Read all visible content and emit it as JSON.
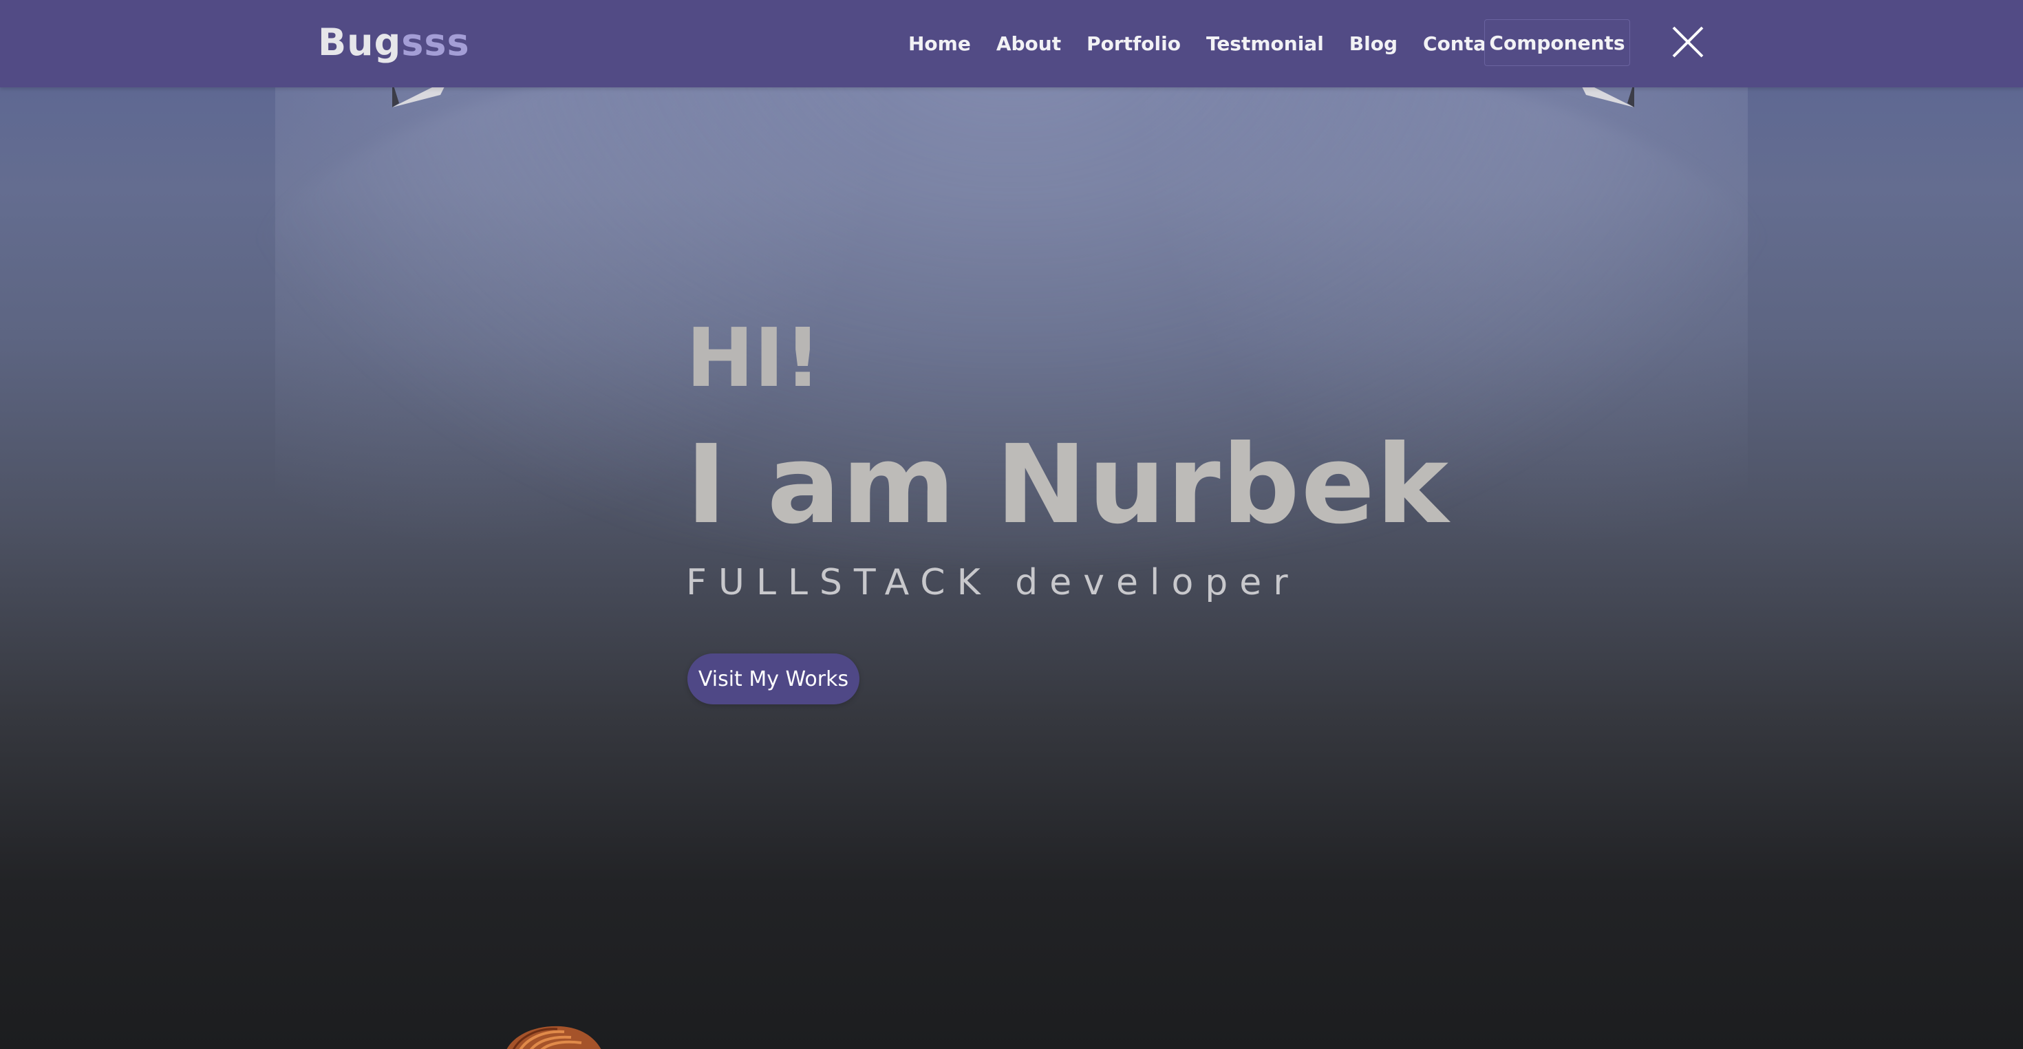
{
  "navbar": {
    "logo_main": "Bug",
    "logo_accent": "sss",
    "links": [
      {
        "label": "Home"
      },
      {
        "label": "About"
      },
      {
        "label": "Portfolio"
      },
      {
        "label": "Testmonial"
      },
      {
        "label": "Blog"
      },
      {
        "label": "Contact"
      }
    ],
    "components_label": "Components",
    "close_icon": "close-icon"
  },
  "hero": {
    "greeting": "HI!",
    "headline": "I am Nurbek",
    "subtitle": "FULLSTACK developer",
    "cta_label": "Visit My Works"
  },
  "colors": {
    "navbar_bg": "#524b85",
    "logo_accent": "#a49ed6",
    "cta_bg": "#4f4886",
    "hero_text": "#bdbbb8"
  },
  "icons": {
    "lamps": "spotlight-lamp-icon",
    "character": "character-hair-icon"
  }
}
